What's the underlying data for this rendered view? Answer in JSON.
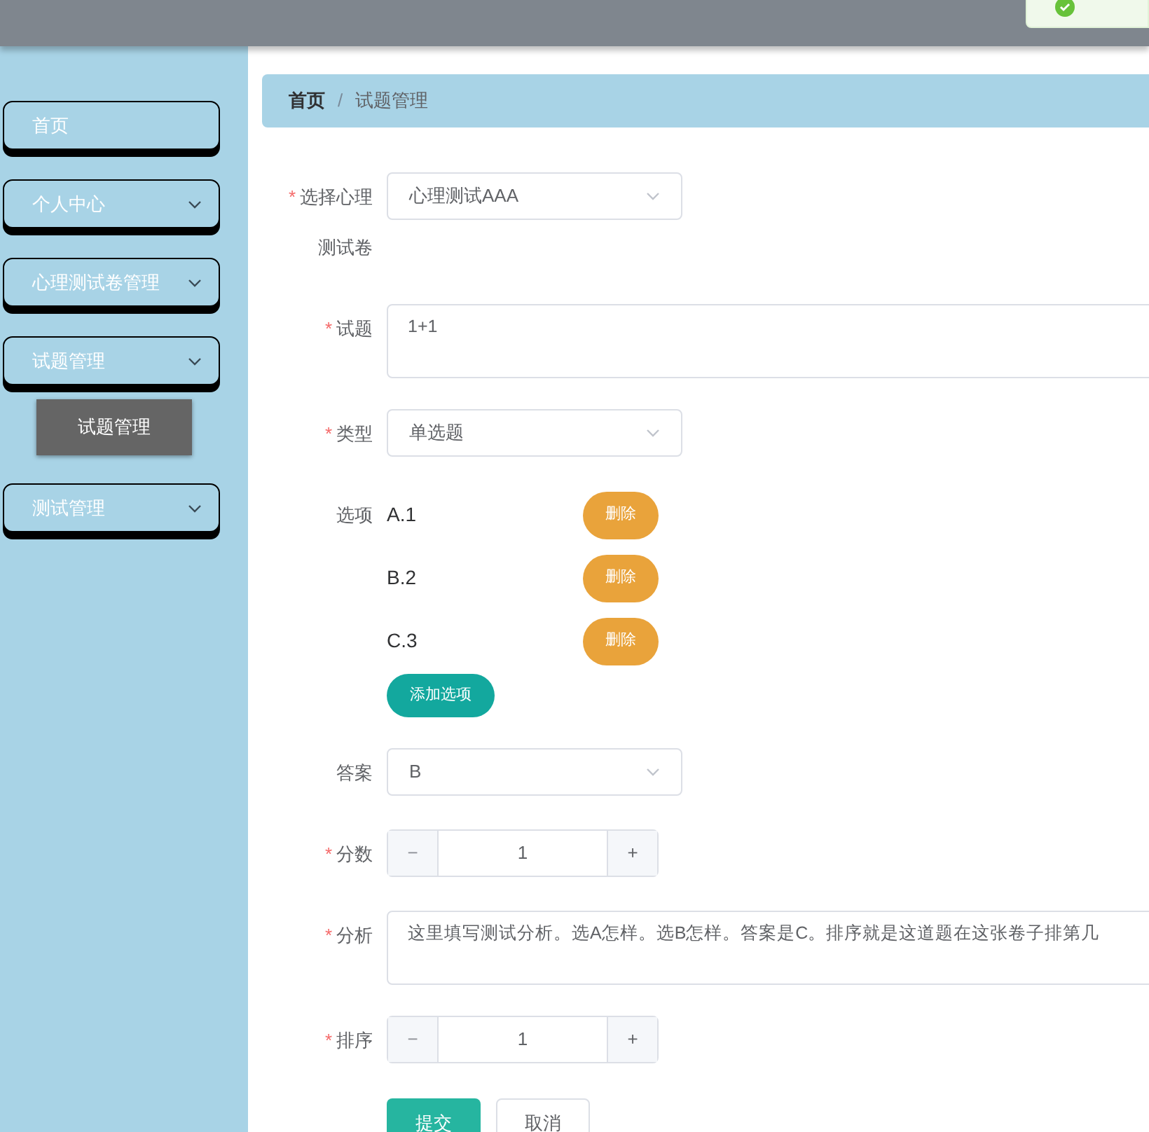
{
  "sidebar": {
    "items": [
      {
        "kind": "link",
        "label": "首页"
      },
      {
        "kind": "submenu",
        "label": "个人中心"
      },
      {
        "kind": "submenu",
        "label": "心理测试卷管理"
      },
      {
        "kind": "submenu",
        "label": "试题管理",
        "children": [
          {
            "label": "试题管理",
            "selected": true
          }
        ]
      },
      {
        "kind": "submenu",
        "label": "测试管理"
      }
    ]
  },
  "breadcrumb": {
    "items": [
      "首页",
      "试题管理"
    ],
    "separator": "/"
  },
  "form": {
    "fields": [
      {
        "kind": "select",
        "label": "选择心理测试卷",
        "marker": "*",
        "value": "心理测试AAA"
      },
      {
        "kind": "textarea",
        "label": "试题",
        "marker": "*",
        "value": "1+1"
      },
      {
        "kind": "select",
        "label": "类型",
        "marker": "*",
        "value": "单选题"
      },
      {
        "kind": "options",
        "label": "选项",
        "options": [
          {
            "text": "A.1",
            "action": "删除"
          },
          {
            "text": "B.2",
            "action": "删除"
          },
          {
            "text": "C.3",
            "action": "删除"
          }
        ],
        "add_button": "添加选项"
      },
      {
        "kind": "select",
        "label": "答案",
        "value": "B"
      },
      {
        "kind": "number",
        "label": "分数",
        "marker": "*",
        "value": "1",
        "minus": "−",
        "plus": "+"
      },
      {
        "kind": "textarea",
        "label": "分析",
        "marker": "*",
        "value": "这里填写测试分析。选A怎样。选B怎样。答案是C。排序就是这道题在这张卷子排第几"
      },
      {
        "kind": "number",
        "label": "排序",
        "marker": "*",
        "value": "1",
        "minus": "−",
        "plus": "+"
      }
    ],
    "buttons": [
      {
        "kind": "primary",
        "label": "提交"
      },
      {
        "kind": "default",
        "label": "取消"
      }
    ]
  }
}
